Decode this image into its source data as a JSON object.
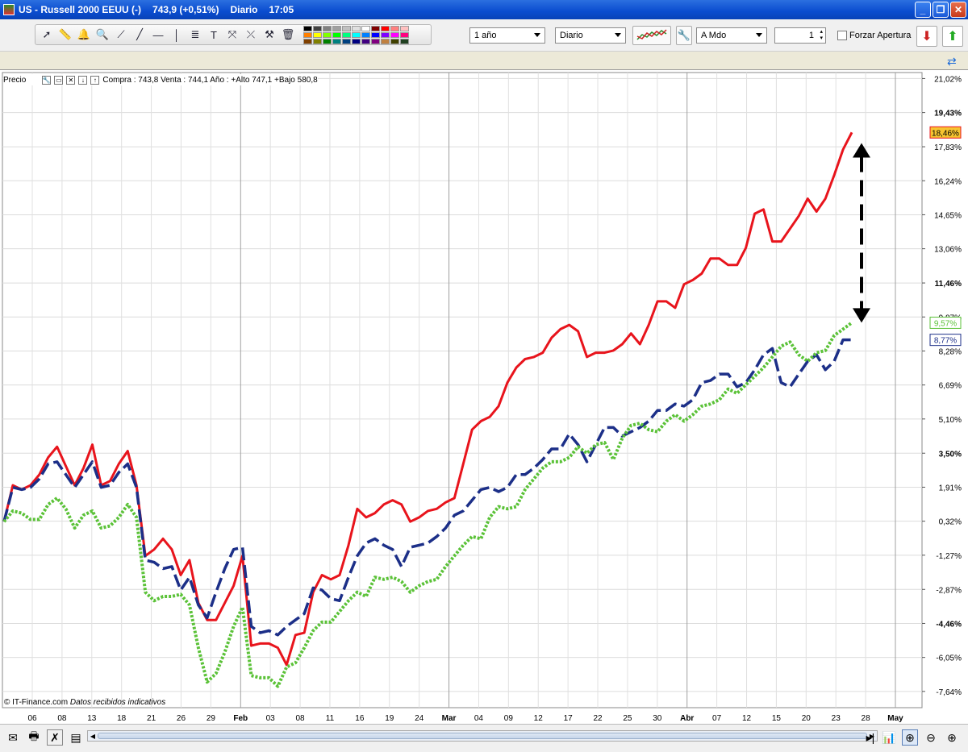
{
  "window": {
    "title_symbol": "US - Russell 2000 EEUU (-)",
    "title_price": "743,9 (+0,51%)",
    "title_period": "Diario",
    "title_time": "17:05"
  },
  "toolbar": {
    "period_select": "1 año",
    "interval_select": "Diario",
    "mode_select": "A Mdo",
    "spin_value": "1",
    "forzar_label": "Forzar Apertura"
  },
  "palette_colors": [
    "#000000",
    "#404040",
    "#808080",
    "#a0a0a0",
    "#c0c0c0",
    "#e0e0e0",
    "#ffffff",
    "#800000",
    "#ff0000",
    "#ff8080",
    "#ffc0c0",
    "#ff8000",
    "#ffff00",
    "#80ff00",
    "#00ff00",
    "#00ff80",
    "#00ffff",
    "#0080ff",
    "#0000ff",
    "#8000ff",
    "#ff00ff",
    "#ff0080",
    "#804000",
    "#808000",
    "#008000",
    "#008080",
    "#004080",
    "#000080",
    "#400080",
    "#800080",
    "#c08040",
    "#404000",
    "#204020"
  ],
  "info": {
    "price_label": "Precio",
    "quote_text": "Compra : 743,8 Venta : 744,1  Año : +Alto 747,1 +Bajo 580,8"
  },
  "credit": {
    "source": "© IT-Finance.com",
    "note": "Datos recibidos indicativos"
  },
  "chart_data": {
    "type": "line",
    "y_unit": "%",
    "ylim": [
      -8.4,
      21.3
    ],
    "y_ticks": [
      "21,02%",
      "19,43%",
      "17,83%",
      "16,24%",
      "14,65%",
      "13,06%",
      "11,46%",
      "9,87%",
      "8,28%",
      "6,69%",
      "5,10%",
      "3,50%",
      "1,91%",
      "0,32%",
      "-1,27%",
      "-2,87%",
      "-4,46%",
      "-6,05%",
      "-7,64%"
    ],
    "y_ticks_bold": [
      "19,43%",
      "11,46%",
      "3,50%",
      "-4,46%"
    ],
    "x_tick_labels": [
      "06",
      "08",
      "13",
      "18",
      "21",
      "26",
      "29",
      "Feb",
      "03",
      "08",
      "11",
      "16",
      "19",
      "24",
      "Mar",
      "04",
      "09",
      "12",
      "17",
      "22",
      "25",
      "30",
      "Abr",
      "07",
      "12",
      "15",
      "20",
      "23",
      "28",
      "May"
    ],
    "x_tick_bold": [
      "Feb",
      "Mar",
      "Abr",
      "May"
    ],
    "month_separators": [
      "Feb",
      "Mar",
      "Abr",
      "May"
    ],
    "grid": true,
    "series": [
      {
        "color": "#e8141c",
        "style": "solid",
        "last_label": "18,46%",
        "label_bg": "#f7c430",
        "values": [
          0.3,
          2.0,
          1.8,
          2.0,
          2.5,
          3.3,
          3.8,
          2.9,
          2.0,
          2.8,
          3.9,
          2.0,
          2.2,
          3.0,
          3.6,
          2.0,
          -1.3,
          -1.0,
          -0.5,
          -1.0,
          -2.2,
          -1.5,
          -3.5,
          -4.3,
          -4.3,
          -3.5,
          -2.7,
          -1.3,
          -5.5,
          -5.4,
          -5.4,
          -5.6,
          -6.4,
          -5.0,
          -4.9,
          -3.0,
          -2.2,
          -2.4,
          -2.2,
          -0.8,
          0.9,
          0.5,
          0.7,
          1.1,
          1.3,
          1.1,
          0.3,
          0.5,
          0.8,
          0.9,
          1.2,
          1.4,
          3.0,
          4.6,
          5.0,
          5.2,
          5.7,
          6.8,
          7.5,
          7.9,
          8.0,
          8.2,
          8.9,
          9.3,
          9.5,
          9.2,
          8.0,
          8.2,
          8.2,
          8.3,
          8.6,
          9.1,
          8.6,
          9.5,
          10.6,
          10.6,
          10.3,
          11.4,
          11.6,
          11.9,
          12.6,
          12.6,
          12.3,
          12.3,
          13.1,
          14.7,
          14.9,
          13.4,
          13.4,
          14.0,
          14.6,
          15.4,
          14.8,
          15.4,
          16.5,
          17.7,
          18.5
        ],
        "dense": true
      },
      {
        "color": "#1c2f88",
        "style": "dashed",
        "last_label": "8,77%",
        "label_bg": "#ffffff",
        "values": [
          0.3,
          1.9,
          1.8,
          1.9,
          2.3,
          3.0,
          3.1,
          2.5,
          1.9,
          2.5,
          3.1,
          1.9,
          2.0,
          2.6,
          3.0,
          1.9,
          -1.5,
          -1.6,
          -1.9,
          -1.8,
          -2.9,
          -2.3,
          -3.6,
          -4.2,
          -3.0,
          -1.9,
          -1.0,
          -0.9,
          -4.6,
          -4.9,
          -4.8,
          -5.0,
          -4.6,
          -4.3,
          -4.0,
          -2.8,
          -2.9,
          -3.3,
          -3.4,
          -2.3,
          -1.3,
          -0.7,
          -0.5,
          -0.8,
          -1.0,
          -1.8,
          -0.9,
          -0.8,
          -0.7,
          -0.4,
          0.0,
          0.6,
          0.8,
          1.3,
          1.8,
          1.9,
          1.7,
          1.9,
          2.5,
          2.5,
          2.8,
          3.2,
          3.7,
          3.7,
          4.4,
          3.9,
          3.1,
          3.9,
          4.7,
          4.7,
          4.3,
          4.5,
          4.7,
          5.0,
          5.5,
          5.5,
          5.8,
          5.7,
          6.0,
          6.8,
          6.9,
          7.2,
          7.2,
          6.6,
          6.8,
          7.4,
          8.1,
          8.4,
          6.8,
          6.6,
          7.2,
          7.8,
          8.1,
          7.4,
          7.8,
          8.8,
          8.8
        ],
        "dense": true
      },
      {
        "color": "#5bc238",
        "style": "dotted",
        "last_label": "9,57%",
        "label_bg": "#ffffff",
        "values": [
          0.3,
          0.8,
          0.7,
          0.4,
          0.4,
          1.1,
          1.4,
          0.9,
          0.0,
          0.6,
          0.8,
          0.0,
          0.1,
          0.5,
          1.1,
          0.5,
          -3.0,
          -3.4,
          -3.2,
          -3.2,
          -3.1,
          -3.6,
          -5.6,
          -7.2,
          -6.8,
          -5.8,
          -4.6,
          -3.7,
          -6.9,
          -7.0,
          -7.0,
          -7.4,
          -6.5,
          -6.3,
          -5.6,
          -4.8,
          -4.4,
          -4.4,
          -3.9,
          -3.4,
          -3.0,
          -3.2,
          -2.3,
          -2.4,
          -2.3,
          -2.5,
          -3.0,
          -2.7,
          -2.5,
          -2.4,
          -1.8,
          -1.3,
          -0.8,
          -0.4,
          -0.5,
          0.5,
          1.0,
          0.9,
          1.0,
          1.8,
          2.3,
          2.8,
          3.1,
          3.1,
          3.3,
          3.8,
          3.5,
          3.9,
          4.0,
          3.2,
          4.2,
          4.8,
          4.9,
          4.6,
          4.5,
          5.0,
          5.3,
          5.0,
          5.3,
          5.7,
          5.8,
          6.0,
          6.5,
          6.3,
          6.7,
          7.1,
          7.5,
          8.0,
          8.5,
          8.7,
          8.1,
          7.8,
          8.2,
          8.3,
          9.0,
          9.3,
          9.6
        ],
        "dense": true
      }
    ],
    "annotation_arrow": {
      "from": 18.0,
      "to": 9.6,
      "style": "dashed-black-double-arrow"
    }
  }
}
